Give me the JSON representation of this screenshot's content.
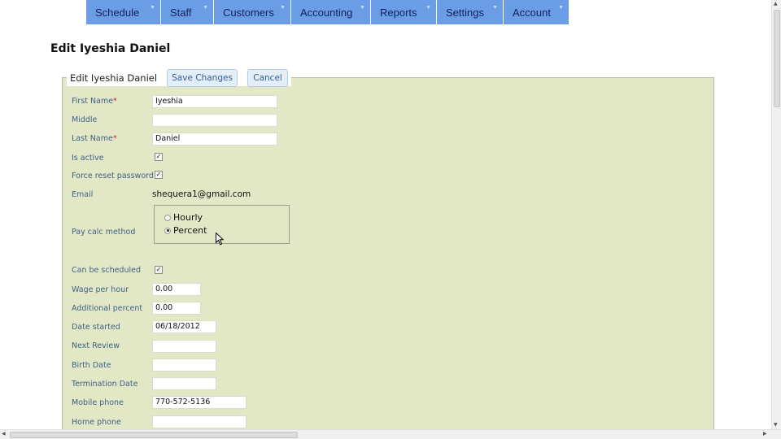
{
  "nav": {
    "items": [
      {
        "label": "Schedule"
      },
      {
        "label": "Staff"
      },
      {
        "label": "Customers"
      },
      {
        "label": "Accounting"
      },
      {
        "label": "Reports"
      },
      {
        "label": "Settings"
      },
      {
        "label": "Account"
      }
    ],
    "arrow": "▼",
    "color": "#6b9de6"
  },
  "page_title": "Edit Iyeshia Daniel",
  "form": {
    "legend": "Edit Iyeshia Daniel",
    "save_label": "Save Changes",
    "cancel_label": "Cancel",
    "required_mark": "*",
    "first_name": {
      "label": "First Name",
      "value": "Iyeshia"
    },
    "middle": {
      "label": "Middle",
      "value": ""
    },
    "last_name": {
      "label": "Last Name",
      "value": "Daniel"
    },
    "is_active": {
      "label": "Is active",
      "checked": true
    },
    "force_reset": {
      "label": "Force reset password",
      "checked": true
    },
    "email": {
      "label": "Email",
      "value": "shequera1@gmail.com"
    },
    "pay_calc": {
      "label": "Pay calc method",
      "options": [
        {
          "label": "Hourly",
          "selected": false
        },
        {
          "label": "Percent",
          "selected": true
        }
      ]
    },
    "can_be_scheduled": {
      "label": "Can be scheduled",
      "checked": true
    },
    "wage_per_hour": {
      "label": "Wage per hour",
      "value": "0.00"
    },
    "additional_percent": {
      "label": "Additional percent",
      "value": "0.00"
    },
    "date_started": {
      "label": "Date started",
      "value": "06/18/2012"
    },
    "next_review": {
      "label": "Next Review",
      "value": ""
    },
    "birth_date": {
      "label": "Birth Date",
      "value": ""
    },
    "termination_date": {
      "label": "Termination Date",
      "value": ""
    },
    "mobile_phone": {
      "label": "Mobile phone",
      "value": "770-572-5136"
    },
    "home_phone": {
      "label": "Home phone",
      "value": ""
    }
  },
  "check_glyph": "✓",
  "panel_color": "#e2e8c6"
}
